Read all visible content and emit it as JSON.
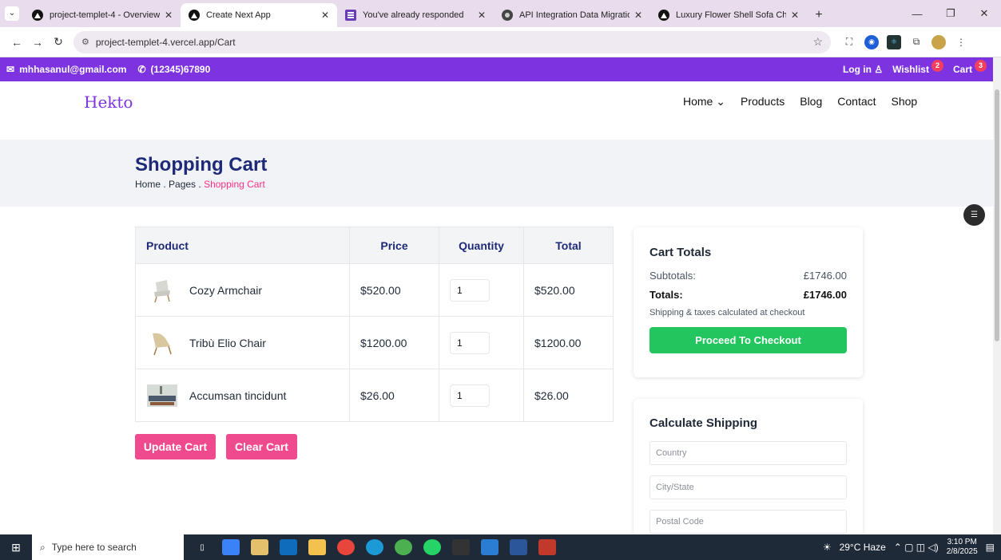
{
  "browser": {
    "tabs": [
      {
        "title": "project-templet-4 - Overview -",
        "active": false,
        "icon": "vercel-icon"
      },
      {
        "title": "Create Next App",
        "active": true,
        "icon": "vercel-icon"
      },
      {
        "title": "You've already responded",
        "active": false,
        "icon": "forms-icon"
      },
      {
        "title": "API Integration Data Migration",
        "active": false,
        "icon": "openai-icon"
      },
      {
        "title": "Luxury Flower Shell Sofa Chair |",
        "active": false,
        "icon": "vercel-icon"
      }
    ],
    "url": "project-templet-4.vercel.app/Cart"
  },
  "topbar": {
    "email": "mhhasanul@gmail.com",
    "phone": "(12345)67890",
    "login": "Log in",
    "wishlist": "Wishlist",
    "wishlist_count": "2",
    "cart": "Cart",
    "cart_count": "3"
  },
  "header": {
    "logo": "Hekto",
    "nav": [
      "Home",
      "Products",
      "Blog",
      "Contact",
      "Shop"
    ]
  },
  "page": {
    "title": "Shopping Cart",
    "breadcrumb": {
      "home": "Home .",
      "pages": "Pages .",
      "current": "Shopping Cart"
    }
  },
  "cart": {
    "headers": {
      "product": "Product",
      "price": "Price",
      "quantity": "Quantity",
      "total": "Total"
    },
    "items": [
      {
        "name": "Cozy Armchair",
        "price": "$520.00",
        "qty": "1",
        "total": "$520.00"
      },
      {
        "name": "Tribù Elio Chair",
        "price": "$1200.00",
        "qty": "1",
        "total": "$1200.00"
      },
      {
        "name": "Accumsan tincidunt",
        "price": "$26.00",
        "qty": "1",
        "total": "$26.00"
      }
    ],
    "update_label": "Update Cart",
    "clear_label": "Clear Cart"
  },
  "totals": {
    "title": "Cart Totals",
    "subtotal_label": "Subtotals:",
    "subtotal_value": "£1746.00",
    "total_label": "Totals:",
    "total_value": "£1746.00",
    "note": "Shipping & taxes calculated at checkout",
    "checkout_label": "Proceed To Checkout"
  },
  "shipping": {
    "title": "Calculate Shipping",
    "country_placeholder": "Country",
    "city_placeholder": "City/State",
    "postal_placeholder": "Postal Code"
  },
  "taskbar": {
    "search_placeholder": "Type here to search",
    "weather": "29°C Haze",
    "time": "3:10 PM",
    "date": "2/8/2025"
  }
}
